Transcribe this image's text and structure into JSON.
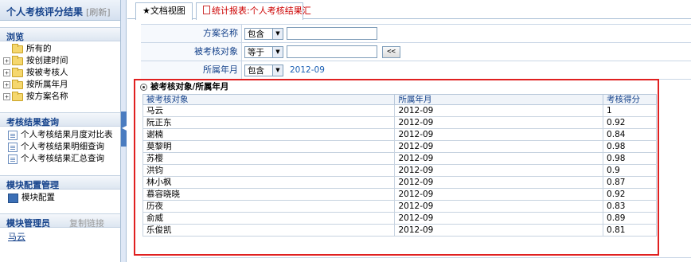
{
  "sidebar": {
    "app_title": "个人考核评分结果",
    "refresh_label": "[刷新]",
    "browse": {
      "header": "浏览",
      "items": [
        {
          "label": "所有的",
          "expandable": false
        },
        {
          "label": "按创建时间",
          "expandable": true
        },
        {
          "label": "按被考核人",
          "expandable": true
        },
        {
          "label": "按所属年月",
          "expandable": true
        },
        {
          "label": "按方案名称",
          "expandable": true
        }
      ]
    },
    "query": {
      "header": "考核结果查询",
      "items": [
        {
          "label": "个人考核结果月度对比表"
        },
        {
          "label": "个人考核结果明细查询"
        },
        {
          "label": "个人考核结果汇总查询"
        }
      ]
    },
    "config": {
      "header": "模块配置管理",
      "items": [
        {
          "label": "模块配置"
        }
      ]
    },
    "admin": {
      "header": "模块管理员",
      "copy_label": "复制链接",
      "user": "马云"
    }
  },
  "tabs": {
    "doc_view": "★文档视图",
    "report": "统计报表:个人考核结果汇"
  },
  "filters": {
    "scheme": {
      "label": "方案名称",
      "operator": "包含",
      "value": ""
    },
    "target": {
      "label": "被考核对象",
      "operator": "等于",
      "value": "",
      "button": "<<"
    },
    "month": {
      "label": "所属年月",
      "operator": "包含",
      "value": "2012-09"
    }
  },
  "results": {
    "group_title": "被考核对象/所属年月",
    "columns": [
      "被考核对象",
      "所属年月",
      "考核得分"
    ],
    "rows": [
      {
        "name": "马云",
        "month": "2012-09",
        "score": "1"
      },
      {
        "name": "阮正东",
        "month": "2012-09",
        "score": "0.92"
      },
      {
        "name": "谢楠",
        "month": "2012-09",
        "score": "0.84"
      },
      {
        "name": "莫黎明",
        "month": "2012-09",
        "score": "0.98"
      },
      {
        "name": "苏樱",
        "month": "2012-09",
        "score": "0.98"
      },
      {
        "name": "洪钧",
        "month": "2012-09",
        "score": "0.9"
      },
      {
        "name": "林小枫",
        "month": "2012-09",
        "score": "0.87"
      },
      {
        "name": "慕容晓晓",
        "month": "2012-09",
        "score": "0.92"
      },
      {
        "name": "历夜",
        "month": "2012-09",
        "score": "0.83"
      },
      {
        "name": "俞威",
        "month": "2012-09",
        "score": "0.89"
      },
      {
        "name": "乐俊凯",
        "month": "2012-09",
        "score": "0.81"
      }
    ]
  }
}
